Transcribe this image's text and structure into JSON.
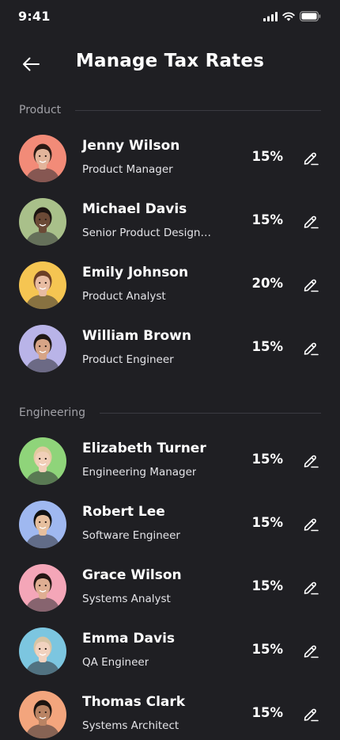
{
  "status_bar": {
    "time": "9:41"
  },
  "header": {
    "title": "Manage Tax Rates"
  },
  "sections": [
    {
      "title": "Product",
      "people": [
        {
          "name": "Jenny Wilson",
          "role": "Product Manager",
          "rate": "15%",
          "avatar_bg": "#f28b78",
          "skin": "#e2b49a",
          "hair": "#2b1a14"
        },
        {
          "name": "Michael Davis",
          "role": "Senior Product Design…",
          "rate": "15%",
          "avatar_bg": "#a9c08a",
          "skin": "#6b4a36",
          "hair": "#1b1411"
        },
        {
          "name": "Emily Johnson",
          "role": "Product Analyst",
          "rate": "20%",
          "avatar_bg": "#f5c552",
          "skin": "#e8bca2",
          "hair": "#6b3f26"
        },
        {
          "name": "William Brown",
          "role": "Product Engineer",
          "rate": "15%",
          "avatar_bg": "#b9b4e8",
          "skin": "#d6a486",
          "hair": "#1f1814"
        }
      ]
    },
    {
      "title": "Engineering",
      "people": [
        {
          "name": "Elizabeth Turner",
          "role": "Engineering Manager",
          "rate": "15%",
          "avatar_bg": "#8fd47a",
          "skin": "#f0cfb8",
          "hair": "#e3c9a0"
        },
        {
          "name": "Robert Lee",
          "role": "Software Engineer",
          "rate": "15%",
          "avatar_bg": "#9fb8f0",
          "skin": "#e6bf9e",
          "hair": "#111111"
        },
        {
          "name": "Grace Wilson",
          "role": "Systems Analyst",
          "rate": "15%",
          "avatar_bg": "#f4a6b8",
          "skin": "#dfae92",
          "hair": "#241714"
        },
        {
          "name": "Emma Davis",
          "role": "QA Engineer",
          "rate": "15%",
          "avatar_bg": "#7cc6e0",
          "skin": "#f1d2bf",
          "hair": "#d8c4a4"
        },
        {
          "name": "Thomas Clark",
          "role": "Systems Architect",
          "rate": "15%",
          "avatar_bg": "#f3a57d",
          "skin": "#b98363",
          "hair": "#1c1410"
        }
      ]
    }
  ]
}
